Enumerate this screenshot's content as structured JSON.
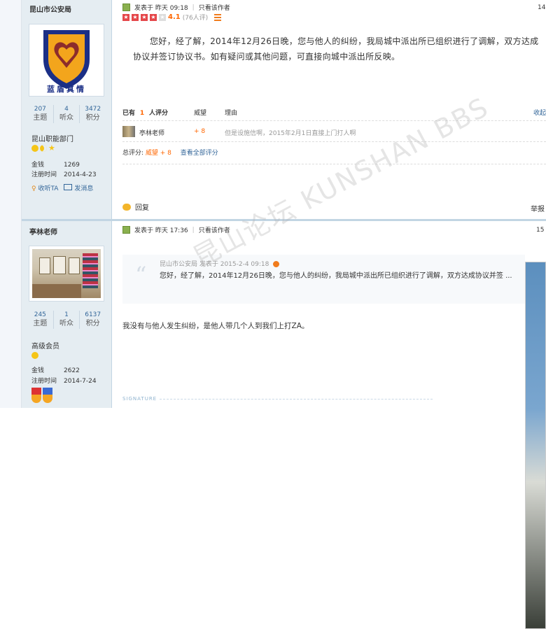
{
  "posts": [
    {
      "author": "昆山市公安局",
      "avatar_caption": "蓝盾真情",
      "stats": [
        {
          "n": "207",
          "l": "主题"
        },
        {
          "n": "4",
          "l": "听众"
        },
        {
          "n": "3472",
          "l": "积分"
        }
      ],
      "group": "昆山职能部门",
      "money_label": "金钱",
      "money": "1269",
      "reg_label": "注册时间",
      "reg": "2014-4-23",
      "follow": "收听TA",
      "message": "发消息",
      "posted": "发表于 昨天 09:18",
      "only_author": "只看该作者",
      "floor": "14",
      "rating_score": "4.1",
      "rating_count": "(76人评)",
      "content": "您好，经了解，2014年12月26日晚，您与他人的纠纷，我局城中派出所已组织进行了调解，双方达成协议并签订协议书。如有疑问或其他问题，可直接向城中派出所反映。",
      "rate_header": {
        "prefix": "已有",
        "count": "1",
        "suffix": "人评分",
        "col_weiwang": "威望",
        "col_reason": "理由",
        "collapse": "收起"
      },
      "rate_row": {
        "user": "亭林老师",
        "points": "+ 8",
        "reason": "但是设施信啊，2015年2月1日直接上门打人啊"
      },
      "rate_total": {
        "label": "总评分:",
        "value": "威望 + 8",
        "view_all": "查看全部评分"
      },
      "reply": "回复",
      "report": "举报"
    },
    {
      "author": "亭林老师",
      "stats": [
        {
          "n": "245",
          "l": "主题"
        },
        {
          "n": "1",
          "l": "听众"
        },
        {
          "n": "6137",
          "l": "积分"
        }
      ],
      "group": "高级会员",
      "money_label": "金钱",
      "money": "2622",
      "reg_label": "注册时间",
      "reg": "2014-7-24",
      "posted": "发表于 昨天 17:36",
      "only_author": "只看该作者",
      "floor": "15",
      "quote_head": "昆山市公安局 发表于 2015-2-4 09:18",
      "quote_text": "您好，经了解，2014年12月26日晚，您与他人的纠纷，我局城中派出所已组织进行了调解，双方达成协议并签 ...",
      "content": "我没有与他人发生纠纷，是他人带几个人到我们上打ZA。",
      "signature": "SIGNATURE"
    }
  ],
  "watermark": "昆山论坛 KUNSHAN BBS",
  "colors": {
    "accent": "#336699",
    "orange": "#ff6600",
    "sidebar": "#e5edf2"
  }
}
